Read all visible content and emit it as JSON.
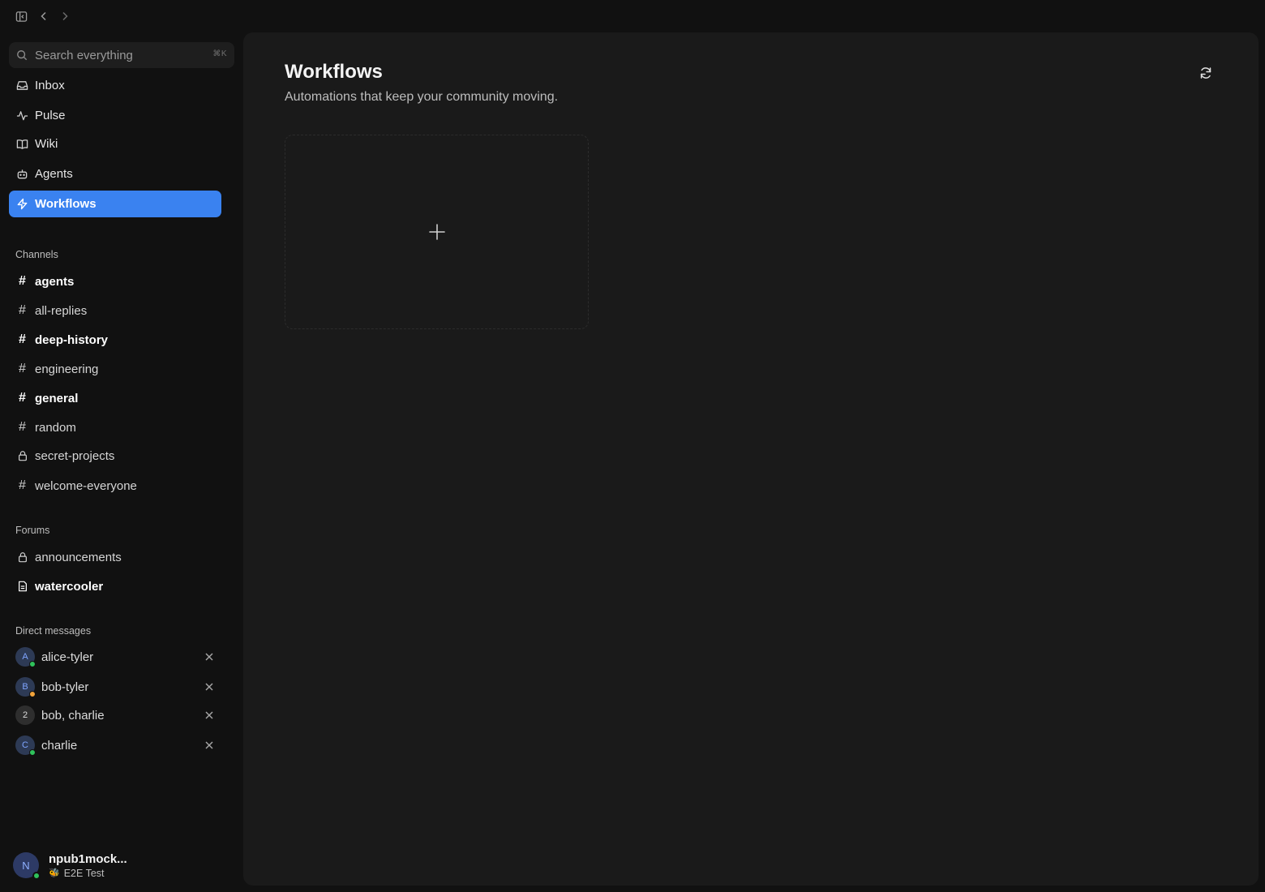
{
  "search": {
    "placeholder": "Search everything",
    "shortcut": "⌘K"
  },
  "nav": [
    {
      "label": "Inbox",
      "icon": "inbox-icon"
    },
    {
      "label": "Pulse",
      "icon": "activity-icon"
    },
    {
      "label": "Wiki",
      "icon": "book-icon"
    },
    {
      "label": "Agents",
      "icon": "bot-icon"
    },
    {
      "label": "Workflows",
      "icon": "bolt-icon",
      "active": true
    }
  ],
  "channels": {
    "heading": "Channels",
    "items": [
      {
        "label": "agents",
        "icon": "hash-icon",
        "unread": true
      },
      {
        "label": "all-replies",
        "icon": "hash-icon",
        "unread": false
      },
      {
        "label": "deep-history",
        "icon": "hash-icon",
        "unread": true
      },
      {
        "label": "engineering",
        "icon": "hash-icon",
        "unread": false
      },
      {
        "label": "general",
        "icon": "hash-icon",
        "unread": true
      },
      {
        "label": "random",
        "icon": "hash-icon",
        "unread": false
      },
      {
        "label": "secret-projects",
        "icon": "lock-icon",
        "unread": false
      },
      {
        "label": "welcome-everyone",
        "icon": "hash-icon",
        "unread": false
      }
    ]
  },
  "forums": {
    "heading": "Forums",
    "items": [
      {
        "label": "announcements",
        "icon": "lock-icon",
        "unread": false
      },
      {
        "label": "watercooler",
        "icon": "document-icon",
        "unread": true
      }
    ]
  },
  "direct_messages": {
    "heading": "Direct messages",
    "items": [
      {
        "label": "alice-tyler",
        "avatar": "A",
        "presence": "#2fc25b"
      },
      {
        "label": "bob-tyler",
        "avatar": "B",
        "presence": "#f2a33a"
      },
      {
        "label": "bob, charlie",
        "avatar": "2",
        "presence": null
      },
      {
        "label": "charlie",
        "avatar": "C",
        "presence": "#2fc25b"
      }
    ]
  },
  "profile": {
    "name": "npub1mock...",
    "avatar": "N",
    "status": "E2E Test",
    "status_emoji": "🐝"
  },
  "main": {
    "title": "Workflows",
    "subtitle": "Automations that keep your community moving."
  },
  "colors": {
    "accent": "#3a82f0",
    "online": "#2fc25b",
    "away": "#f2a33a"
  }
}
